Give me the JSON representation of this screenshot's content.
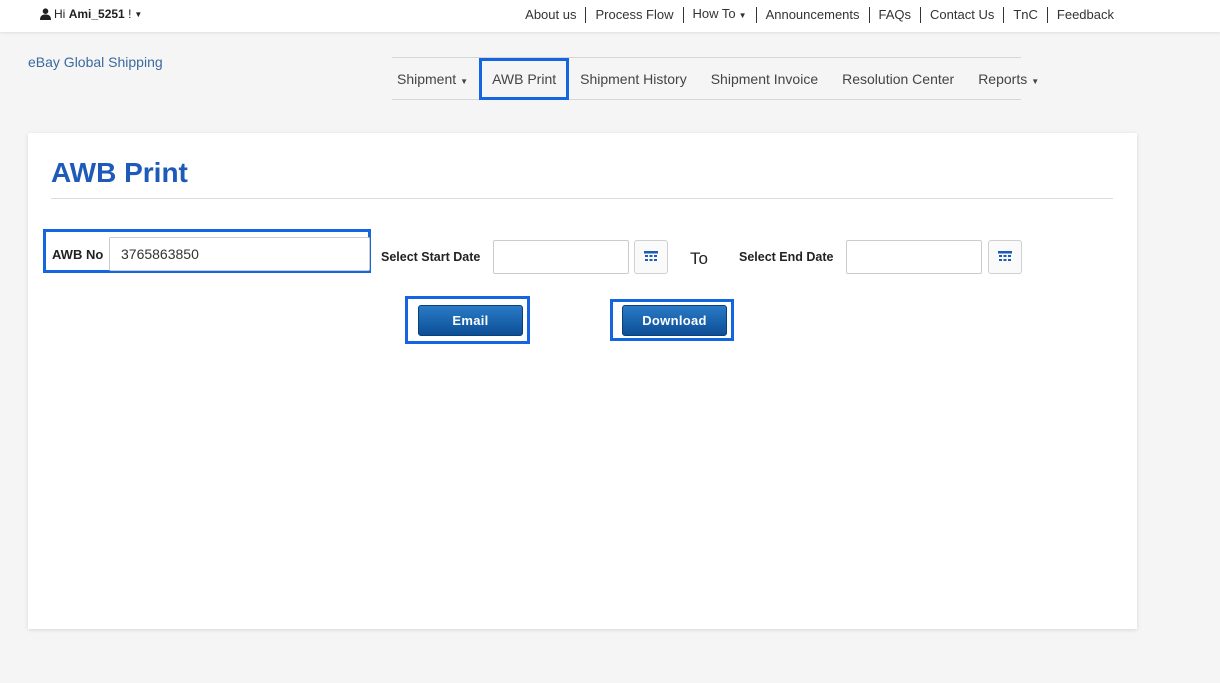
{
  "topbar": {
    "greeting": "Hi",
    "username": "Ami_5251",
    "suffix": "!",
    "links": {
      "about": "About us",
      "process": "Process Flow",
      "howto": "How To",
      "announcements": "Announcements",
      "faqs": "FAQs",
      "contact": "Contact Us",
      "tnc": "TnC",
      "feedback": "Feedback"
    }
  },
  "brand": "eBay Global Shipping",
  "nav": {
    "shipment": "Shipment",
    "awb_print": "AWB Print",
    "history": "Shipment History",
    "invoice": "Shipment Invoice",
    "resolution": "Resolution Center",
    "reports": "Reports"
  },
  "page": {
    "title": "AWB Print",
    "awb_label": "AWB No",
    "awb_value": "3765863850",
    "start_label": "Select Start Date",
    "start_value": "",
    "to_label": "To",
    "end_label": "Select End Date",
    "end_value": "",
    "email_button": "Email",
    "download_button": "Download"
  },
  "colors": {
    "accent": "#1565e0",
    "title": "#1e5bb8",
    "button": "#0d4f97",
    "brand": "#3a6aa0"
  }
}
